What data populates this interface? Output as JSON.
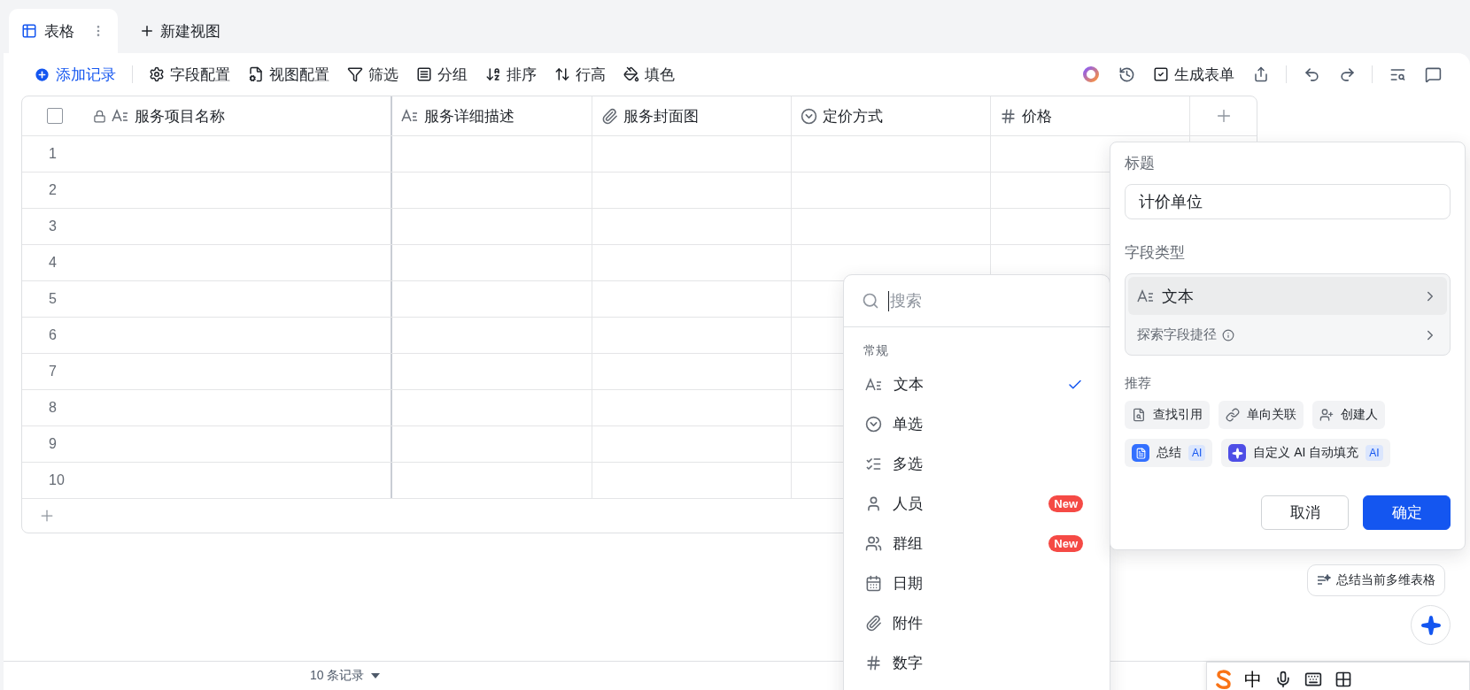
{
  "tabs": [
    {
      "label": "表格",
      "selected": true
    }
  ],
  "new_view": "新建视图",
  "toolbar": {
    "add_record": "添加记录",
    "items": [
      "字段配置",
      "视图配置",
      "筛选",
      "分组",
      "排序",
      "行高",
      "填色"
    ],
    "generate_form": "生成表单"
  },
  "table": {
    "select_all": {
      "checked": false
    },
    "columns": [
      {
        "name": "服务项目名称",
        "kind": "text",
        "locked": true
      },
      {
        "name": "服务详细描述",
        "kind": "text",
        "locked": false
      },
      {
        "name": "服务封面图",
        "kind": "attachment",
        "locked": false
      },
      {
        "name": "定价方式",
        "kind": "single_select",
        "locked": false
      },
      {
        "name": "价格",
        "kind": "number",
        "locked": false
      }
    ],
    "rows": [
      "1",
      "2",
      "3",
      "4",
      "5",
      "6",
      "7",
      "8",
      "9",
      "10"
    ]
  },
  "footer": {
    "record_count": "10 条记录"
  },
  "field_type_menu": {
    "search_placeholder": "搜索",
    "section": "常规",
    "items": [
      {
        "label": "文本",
        "kind": "text",
        "selected": true
      },
      {
        "label": "单选",
        "kind": "single_select",
        "selected": false
      },
      {
        "label": "多选",
        "kind": "multi_select",
        "selected": false
      },
      {
        "label": "人员",
        "kind": "person",
        "selected": false,
        "badge": "New"
      },
      {
        "label": "群组",
        "kind": "group",
        "selected": false,
        "badge": "New"
      },
      {
        "label": "日期",
        "kind": "date",
        "selected": false
      },
      {
        "label": "附件",
        "kind": "attachment",
        "selected": false
      },
      {
        "label": "数字",
        "kind": "number",
        "selected": false
      }
    ]
  },
  "field_panel": {
    "title_label": "标题",
    "title_value": "计价单位",
    "type_label": "字段类型",
    "type_value": "文本",
    "shortcut": "探索字段捷径",
    "recommend_label": "推荐",
    "recommendations": [
      {
        "label": "查找引用",
        "kind": "lookup"
      },
      {
        "label": "单向关联",
        "kind": "link"
      },
      {
        "label": "创建人",
        "kind": "creator"
      },
      {
        "label": "总结",
        "kind": "summary",
        "badge": "AI"
      },
      {
        "label": "自定义 AI 自动填充",
        "kind": "ai_fill",
        "badge": "AI"
      }
    ],
    "cancel": "取消",
    "confirm": "确定"
  },
  "ai_prompt": "总结当前多维表格",
  "ime": {
    "mode": "中"
  }
}
